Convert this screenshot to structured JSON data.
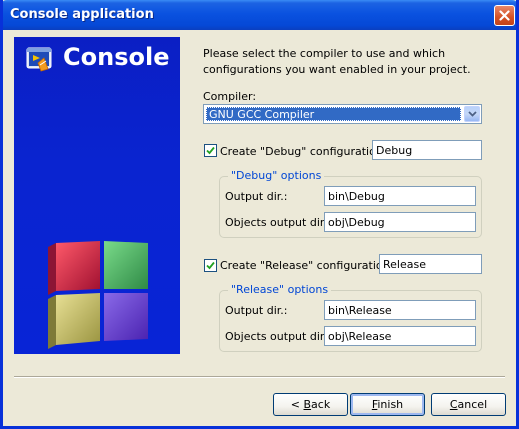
{
  "window": {
    "title": "Console application"
  },
  "side_panel": {
    "logo_text": "Console",
    "logo_icon": "console-app-icon",
    "decoration": "colored-cubes"
  },
  "intro_text": "Please select the compiler to use and which configurations you want enabled in your project.",
  "compiler": {
    "label": "Compiler:",
    "selected": "GNU GCC Compiler"
  },
  "debug": {
    "checkbox_label": "Create \"Debug\" configuration:",
    "checked": true,
    "config_name": "Debug",
    "group_title": "\"Debug\" options",
    "output_dir_label": "Output dir.:",
    "output_dir": "bin\\Debug",
    "objects_dir_label": "Objects output dir.:",
    "objects_dir": "obj\\Debug"
  },
  "release": {
    "checkbox_label": "Create \"Release\" configuration:",
    "checked": true,
    "config_name": "Release",
    "group_title": "\"Release\" options",
    "output_dir_label": "Output dir.:",
    "output_dir": "bin\\Release",
    "objects_dir_label": "Objects output dir.:",
    "objects_dir": "obj\\Release"
  },
  "buttons": {
    "back_mnemonic": "B",
    "back_rest": "ack",
    "back_prefix": "< ",
    "finish_mnemonic": "F",
    "finish_rest": "inish",
    "cancel_mnemonic": "C",
    "cancel_rest": "ancel"
  },
  "colors": {
    "title_bar": "#0a52e0",
    "side_panel": "#0a24d0",
    "group_title": "#0046d5",
    "selection": "#316ac5"
  }
}
